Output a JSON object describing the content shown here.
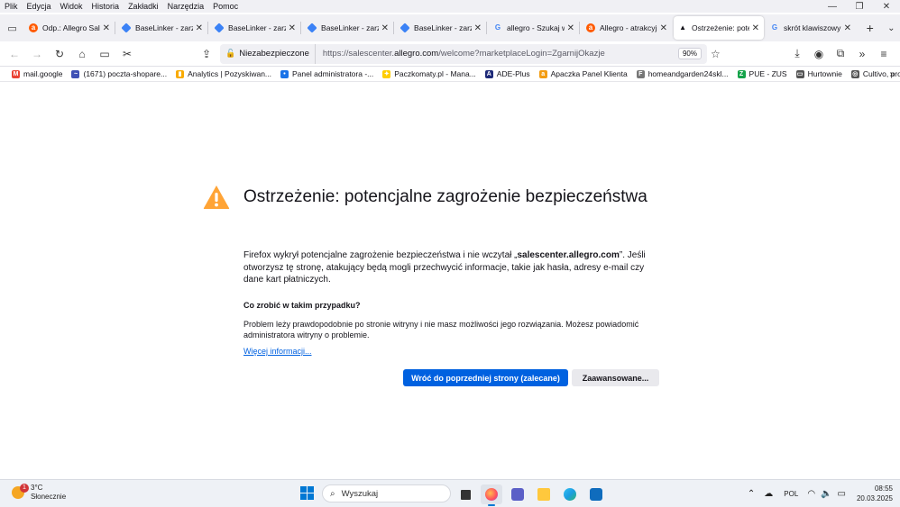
{
  "menubar": {
    "items": [
      "Plik",
      "Edycja",
      "Widok",
      "Historia",
      "Zakładki",
      "Narzędzia",
      "Pomoc"
    ]
  },
  "tabs": [
    {
      "label": "Odp.: Allegro Sales",
      "favicon": "allegro-icon",
      "color": "#ff5a00",
      "active": false
    },
    {
      "label": "BaseLinker - zarząd",
      "favicon": "baselinker-icon",
      "color": "#3b82f6",
      "active": false
    },
    {
      "label": "BaseLinker - zarząd",
      "favicon": "baselinker-icon",
      "color": "#3b82f6",
      "active": false
    },
    {
      "label": "BaseLinker - zarząd",
      "favicon": "baselinker-icon",
      "color": "#3b82f6",
      "active": false
    },
    {
      "label": "BaseLinker - zarząd",
      "favicon": "baselinker-icon",
      "color": "#3b82f6",
      "active": false
    },
    {
      "label": "allegro - Szukaj w G",
      "favicon": "google-icon",
      "color": "#4285f4",
      "active": false
    },
    {
      "label": "Allegro - atrakcyjne",
      "favicon": "allegro-icon",
      "color": "#ff5a00",
      "active": false
    },
    {
      "label": "Ostrzeżenie: poten",
      "favicon": "warning-icon",
      "color": "#15141a",
      "active": true
    },
    {
      "label": "skrót klawiszowy do",
      "favicon": "google-icon",
      "color": "#4285f4",
      "active": false
    }
  ],
  "navbar": {
    "insecure_label": "Niezabezpieczone",
    "url_prefix": "https://salescenter.",
    "url_host": "allegro.com",
    "url_suffix": "/welcome?marketplaceLogin=ZgarnijOkazje",
    "zoom": "90%"
  },
  "bookmarks": [
    {
      "label": "mail.google",
      "color": "#ea4335",
      "glyph": "M"
    },
    {
      "label": "(1671) poczta-shopare...",
      "color": "#3f51b5",
      "glyph": "~"
    },
    {
      "label": "Analytics | Pozyskiwan...",
      "color": "#f9ab00",
      "glyph": "▮"
    },
    {
      "label": "Panel administratora -...",
      "color": "#1a73e8",
      "glyph": "•"
    },
    {
      "label": "Paczkomaty.pl - Mana...",
      "color": "#ffcd00",
      "glyph": "✦"
    },
    {
      "label": "ADE-Plus",
      "color": "#1e2a78",
      "glyph": "A"
    },
    {
      "label": "Apaczka Panel Klienta",
      "color": "#f39c12",
      "glyph": "a"
    },
    {
      "label": "homeandgarden24skl...",
      "color": "#777777",
      "glyph": "F"
    },
    {
      "label": "PUE - ZUS",
      "color": "#16a34a",
      "glyph": "Z"
    },
    {
      "label": "Hurtownie",
      "color": "#555555",
      "glyph": "▭"
    },
    {
      "label": "Cultivo, producent tun...",
      "color": "#555555",
      "glyph": "◎"
    }
  ],
  "warning": {
    "title": "Ostrzeżenie: potencjalne zagrożenie bezpieczeństwa",
    "desc_before": "Firefox wykrył potencjalne zagrożenie bezpieczeństwa i nie wczytał „",
    "desc_host": "salescenter.allegro.com",
    "desc_after": "”. Jeśli otworzysz tę stronę, atakujący będą mogli przechwycić informacje, takie jak hasła, adresy e-mail czy dane kart płatniczych.",
    "what_heading": "Co zrobić w takim przypadku?",
    "what_text": "Problem leży prawdopodobnie po stronie witryny i nie masz możliwości jego rozwiązania. Możesz powiadomić administratora witryny o problemie.",
    "more_link": "Więcej informacji...",
    "primary_button": "Wróć do poprzedniej strony (zalecane)",
    "secondary_button": "Zaawansowane...",
    "accent_color": "#0061e0",
    "warning_color": "#ffa436"
  },
  "taskbar": {
    "weather_temp": "3°C",
    "weather_desc": "Słonecznie",
    "weather_badge": "1",
    "search_placeholder": "Wyszukaj",
    "language": "POL",
    "time": "08:55",
    "date": "20.03.2025"
  }
}
